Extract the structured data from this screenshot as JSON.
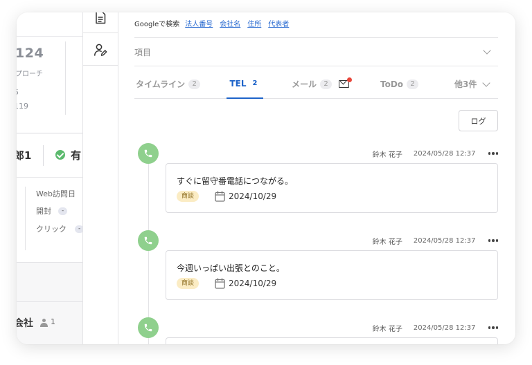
{
  "left_panel": {
    "big_number": "124",
    "sub_label": "プローチ",
    "line2": "5",
    "line3": "119",
    "name": "郎1",
    "status": "有",
    "engagement": {
      "web_visit": "Web訪問日",
      "open": "開封",
      "click": "クリック",
      "open_badge": "-",
      "click_badge": "-"
    },
    "company": "会社",
    "company_count": "1"
  },
  "icon_strip": {
    "items": [
      {
        "icon": "document-icon"
      },
      {
        "icon": "person-edit-icon"
      }
    ]
  },
  "search_bar": {
    "label": "Googleで検索",
    "links": [
      "法人番号",
      "会社名",
      "住所",
      "代表者"
    ]
  },
  "fields": {
    "label": "項目"
  },
  "tabs": [
    {
      "label": "タイムライン",
      "count": "2",
      "active": false
    },
    {
      "label": "TEL",
      "count": "2",
      "active": true
    },
    {
      "label": "メール",
      "count": "2",
      "active": false,
      "unread_indicator": true
    },
    {
      "label": "ToDo",
      "count": "2",
      "active": false
    },
    {
      "label": "他3件",
      "active": false
    }
  ],
  "log_button": "ログ",
  "entries": [
    {
      "author": "鈴木 花子",
      "timestamp": "2024/05/28 12:37",
      "text": "すぐに留守番電話につながる。",
      "tag": "商談",
      "date": "2024/10/29",
      "icon": "phone-icon"
    },
    {
      "author": "鈴木 花子",
      "timestamp": "2024/05/28 12:37",
      "text": "今週いっぱい出張とのこと。",
      "tag": "商談",
      "date": "2024/10/29",
      "icon": "phone-icon"
    },
    {
      "author": "鈴木 花子",
      "timestamp": "2024/05/28 12:37",
      "text": "",
      "tag": "",
      "date": "",
      "icon": "phone-icon"
    }
  ],
  "colors": {
    "accent": "#1d63c9",
    "phone_icon_bg": "#8fd08d",
    "tag_bg": "#fbecc4",
    "notification": "#e8463a"
  }
}
